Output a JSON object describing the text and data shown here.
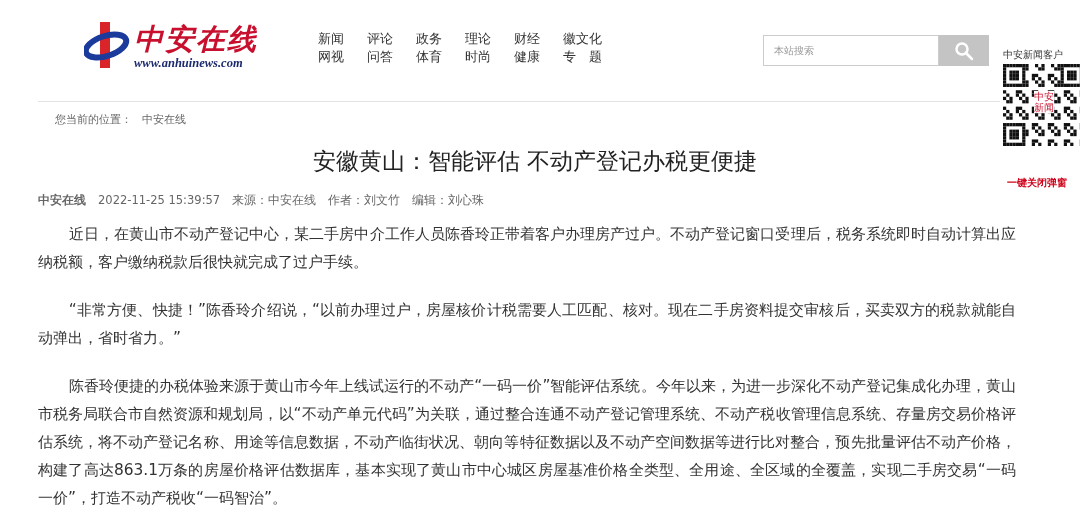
{
  "header": {
    "logo": {
      "name": "中安在线",
      "url": "www.anhuinews.com"
    },
    "nav": [
      [
        "新闻",
        "网视"
      ],
      [
        "评论",
        "问答"
      ],
      [
        "政务",
        "体育"
      ],
      [
        "理论",
        "时尚"
      ],
      [
        "财经",
        "健康"
      ],
      [
        "徽文化",
        "专　题"
      ]
    ],
    "search": {
      "placeholder": "本站搜索"
    }
  },
  "qr_popup": {
    "title": "中安新闻客户",
    "qr_label": "中安新闻",
    "close": "一键关闭弹窗"
  },
  "breadcrumb": {
    "label": "您当前的位置：",
    "items": [
      "中安在线"
    ]
  },
  "article": {
    "title": "安徽黄山：智能评估 不动产登记办税更便捷",
    "meta": {
      "site": "中安在线",
      "date": "2022-11-25 15:39:57",
      "source": "来源：中安在线",
      "author": "作者：刘文竹",
      "editor": "编辑：刘心珠"
    },
    "paragraphs": [
      "近日，在黄山市不动产登记中心，某二手房中介工作人员陈香玲正带着客户办理房产过户。不动产登记窗口受理后，税务系统即时自动计算出应纳税额，客户缴纳税款后很快就完成了过户手续。",
      "“非常方便、快捷！”陈香玲介绍说，“以前办理过户，房屋核价计税需要人工匹配、核对。现在二手房资料提交审核后，买卖双方的税款就能自动弹出，省时省力。”",
      "陈香玲便捷的办税体验来源于黄山市今年上线试运行的不动产“一码一价”智能评估系统。今年以来，为进一步深化不动产登记集成化办理，黄山市税务局联合市自然资源和规划局，以“不动产单元代码”为关联，通过整合连通不动产登记管理系统、不动产税收管理信息系统、存量房交易价格评估系统，将不动产登记名称、用途等信息数据，不动产临街状况、朝向等特征数据以及不动产空间数据等进行比对整合，预先批量评估不动产价格，构建了高达863.1万条的房屋价格评估数据库，基本实现了黄山市中心城区房屋基准价格全类型、全用途、全区域的全覆盖，实现二手房交易“一码一价”，打造不动产税收“一码智治”。"
    ]
  }
}
